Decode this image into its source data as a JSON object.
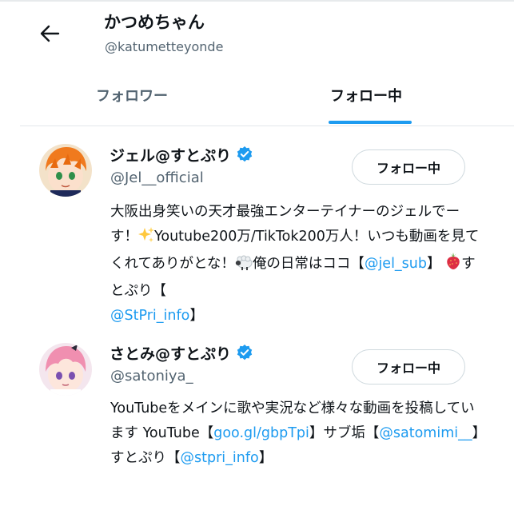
{
  "header": {
    "title": "かつめちゃん",
    "handle": "@katumetteyonde"
  },
  "tabs": [
    {
      "label": "フォロワー",
      "active": false
    },
    {
      "label": "フォロー中",
      "active": true
    }
  ],
  "colors": {
    "accent": "#1d9bf0",
    "text": "#0f1419",
    "muted": "#536471"
  },
  "users": [
    {
      "name": "ジェル@すとぷり",
      "handle": "@Jel__official",
      "verified": true,
      "button_label": "フォロー中",
      "avatar_icon": "orange-hair-character-avatar",
      "bio": {
        "t1": "大阪出身笑いの天才最強エンターテイナーのジェルでーす！",
        "e1": "sparkles-emoji",
        "t2": "Youtube200万/TikTok200万人！いつも動画を見てくれてありがとな！",
        "e2": "sheep-emoji",
        "t3": "俺の日常はココ【",
        "l1": "@jel_sub",
        "t4": "】",
        "e3": "strawberry-emoji",
        "t5": "すとぷり【",
        "l2": "@StPri_info",
        "t6": "】"
      }
    },
    {
      "name": "さとみ@すとぷり",
      "handle": "@satoniya_",
      "verified": true,
      "button_label": "フォロー中",
      "avatar_icon": "pink-hair-character-avatar",
      "bio": {
        "t1": "YouTubeをメインに歌や実況など様々な動画を投稿しています YouTube【",
        "l1": "goo.gl/gbpTpi",
        "t2": "】サブ垢【",
        "l2": "@satomimi__",
        "t3": "】すとぷり【",
        "l3": "@stpri_info",
        "t4": "】"
      }
    }
  ]
}
